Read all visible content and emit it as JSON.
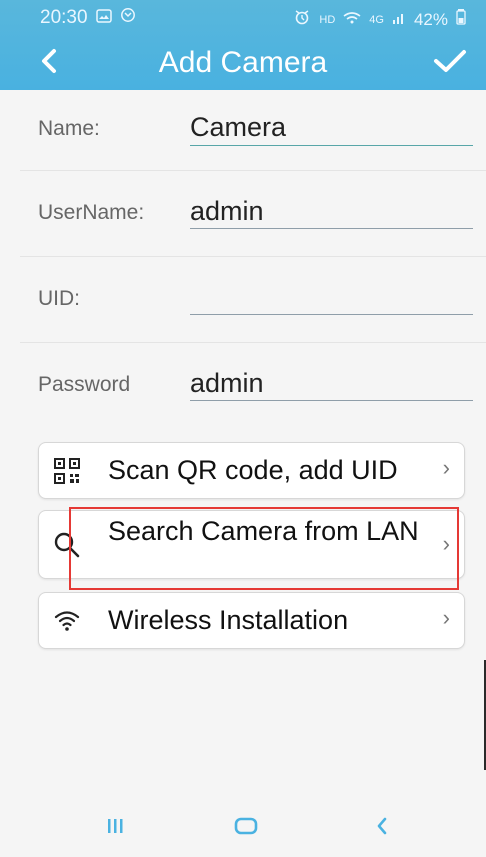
{
  "status_bar": {
    "time": "20:30",
    "left_icons": [
      "photo-icon",
      "sync-icon"
    ],
    "right_icons": [
      "alarm-icon",
      "hd-icon",
      "wifi-icon",
      "signal-icon",
      "battery-icon"
    ],
    "hd_label": "HD",
    "network_label": "4G",
    "battery": "42%"
  },
  "titlebar": {
    "back_icon": "chevron-left-icon",
    "title": "Add Camera",
    "confirm_icon": "check-icon"
  },
  "form": {
    "name": {
      "label": "Name:",
      "value": "Camera"
    },
    "username": {
      "label": "UserName:",
      "value": "admin"
    },
    "uid": {
      "label": "UID:",
      "value": ""
    },
    "password": {
      "label": "Password",
      "value": "admin"
    }
  },
  "actions": [
    {
      "icon": "qr-code-icon",
      "label": "Scan QR code, add UID",
      "arrow": "›"
    },
    {
      "icon": "search-icon",
      "label": "Search Camera from LAN",
      "arrow": "›"
    },
    {
      "icon": "wifi-icon",
      "label": "Wireless Installation",
      "arrow": "›"
    }
  ],
  "bottom_nav": {
    "recent_icon": "recent-apps-icon",
    "home_icon": "home-icon",
    "back_icon": "back-icon"
  },
  "colors": {
    "header_blue": "#4ab2e1",
    "highlight_red": "#e53935",
    "background": "#f5f5f5"
  }
}
